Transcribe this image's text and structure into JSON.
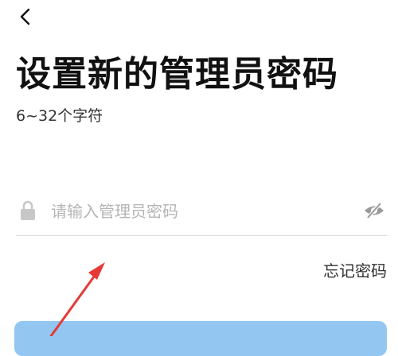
{
  "header": {
    "back_icon": "chevron-left-icon"
  },
  "page": {
    "title": "设置新的管理员密码",
    "subtitle": "6~32个字符"
  },
  "password_field": {
    "placeholder": "请输入管理员密码",
    "value": "",
    "lock_icon": "lock-icon",
    "visibility_icon": "eye-off-icon"
  },
  "links": {
    "forgot_password": "忘记密码"
  },
  "colors": {
    "primary_button": "#93c7f2",
    "annotation": "#e53935"
  },
  "annotation": {
    "icon": "arrow-icon"
  }
}
